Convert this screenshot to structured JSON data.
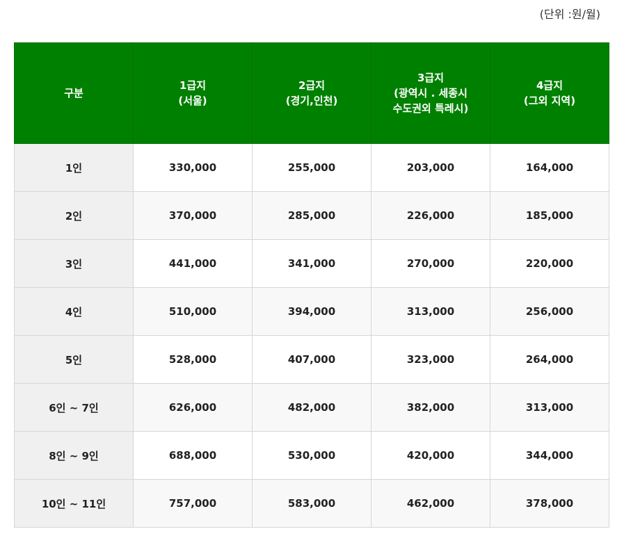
{
  "unit_note": "(단위 :원/월)",
  "columns": [
    "구분",
    "1급지\n(서울)",
    "2급지\n(경기,인천)",
    "3급지\n(광역시 . 세종시\n수도권외 특레시)",
    "4급지\n(그외 지역)"
  ],
  "rows": [
    {
      "label": "1인",
      "values": [
        "330,000",
        "255,000",
        "203,000",
        "164,000"
      ]
    },
    {
      "label": "2인",
      "values": [
        "370,000",
        "285,000",
        "226,000",
        "185,000"
      ]
    },
    {
      "label": "3인",
      "values": [
        "441,000",
        "341,000",
        "270,000",
        "220,000"
      ]
    },
    {
      "label": "4인",
      "values": [
        "510,000",
        "394,000",
        "313,000",
        "256,000"
      ]
    },
    {
      "label": "5인",
      "values": [
        "528,000",
        "407,000",
        "323,000",
        "264,000"
      ]
    },
    {
      "label": "6인 ~ 7인",
      "values": [
        "626,000",
        "482,000",
        "382,000",
        "313,000"
      ]
    },
    {
      "label": "8인 ~ 9인",
      "values": [
        "688,000",
        "530,000",
        "420,000",
        "344,000"
      ]
    },
    {
      "label": "10인 ~ 11인",
      "values": [
        "757,000",
        "583,000",
        "462,000",
        "378,000"
      ]
    }
  ],
  "colors": {
    "header_bg": "#008000",
    "header_text": "#ffffff",
    "label_col_bg": "#f0f0f0",
    "border": "#d6d6d6"
  }
}
